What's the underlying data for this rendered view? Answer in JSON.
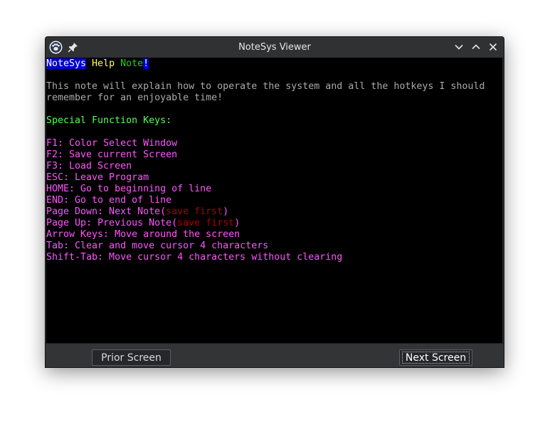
{
  "window": {
    "title": "NoteSys Viewer"
  },
  "icons": {
    "app": "app-icon",
    "pin": "pin-icon",
    "minimize": "chevron-down-icon",
    "maximize": "chevron-up-icon",
    "close": "close-icon"
  },
  "terminal": {
    "header": {
      "part1": "NoteSys",
      "part2": " Help ",
      "part3": "Note",
      "part4": "!"
    },
    "intro_line1": "This note will explain how to operate the system and all the hotkeys I should",
    "intro_line2": "remember for an enjoyable time!",
    "section_title": "Special Function Keys:",
    "keys": [
      "F1: Color Select Window",
      "F2: Save current Screen",
      "F3: Load Screen",
      "ESC: Leave Program",
      "HOME: Go to beginning of line",
      "END: Go to end of line"
    ],
    "page_down": {
      "text": "Page Down: Next Note(",
      "note": "save first",
      "close": ")"
    },
    "page_up": {
      "text": "Page Up: Previous Note(",
      "note": "save first",
      "close": ")"
    },
    "keys_after": [
      "Arrow Keys: Move around the screen",
      "Tab: Clear and move cursor 4 characters",
      "Shift-Tab: Move cursor 4 characters without clearing"
    ]
  },
  "buttons": {
    "prior": "Prior Screen",
    "next": "Next Screen"
  },
  "colors": {
    "terminal_bg": "#000000",
    "selection_bg": "#0000cc",
    "header_yellow": "#ffff55",
    "header_green": "#22cc22",
    "body_gray": "#aaaaaa",
    "section_green": "#55ff55",
    "keys_magenta": "#ff55ff",
    "note_red": "#aa0000"
  }
}
